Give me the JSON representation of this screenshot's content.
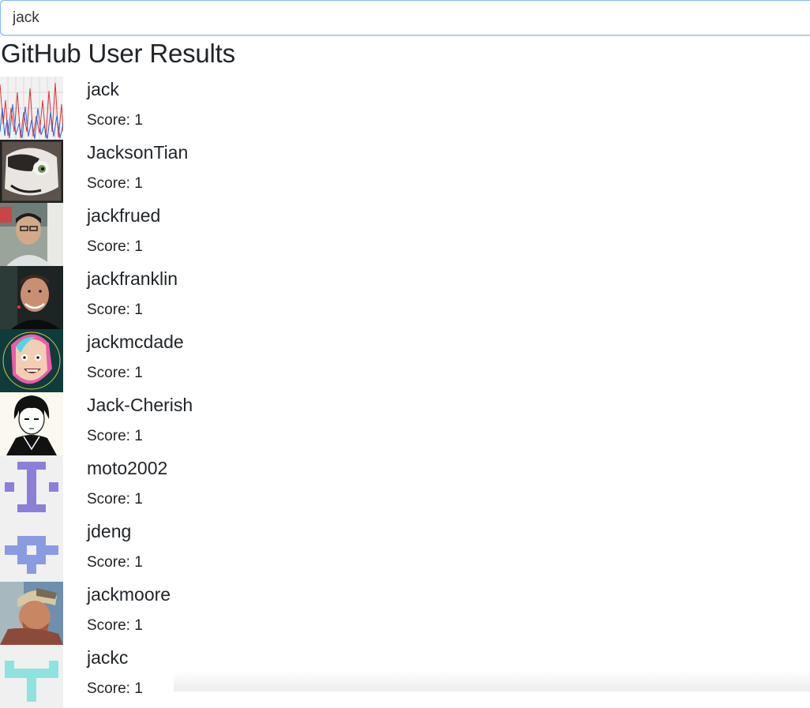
{
  "search": {
    "value": "jack"
  },
  "title": "GitHub User Results",
  "score_prefix": "Score:",
  "users": [
    {
      "login": "jack",
      "score": "Score: 1",
      "avatar": "chart-avatar"
    },
    {
      "login": "JacksonTian",
      "score": "Score: 1",
      "avatar": "cartoon-raccoon-avatar"
    },
    {
      "login": "jackfrued",
      "score": "Score: 1",
      "avatar": "photo-avatar"
    },
    {
      "login": "jackfranklin",
      "score": "Score: 1",
      "avatar": "photo-avatar"
    },
    {
      "login": "jackmcdade",
      "score": "Score: 1",
      "avatar": "illustrated-face-avatar"
    },
    {
      "login": "Jack-Cherish",
      "score": "Score: 1",
      "avatar": "anime-sketch-avatar"
    },
    {
      "login": "moto2002",
      "score": "Score: 1",
      "avatar": "identicon-avatar",
      "color": "#8b7fd9"
    },
    {
      "login": "jdeng",
      "score": "Score: 1",
      "avatar": "identicon-avatar",
      "color": "#8a9be0"
    },
    {
      "login": "jackmoore",
      "score": "Score: 1",
      "avatar": "photo-avatar"
    },
    {
      "login": "jackc",
      "score": "Score: 1",
      "avatar": "identicon-avatar",
      "color": "#8ee3de"
    }
  ],
  "colors": {
    "input_focus_border": "#86b7fe",
    "text": "#212529"
  }
}
